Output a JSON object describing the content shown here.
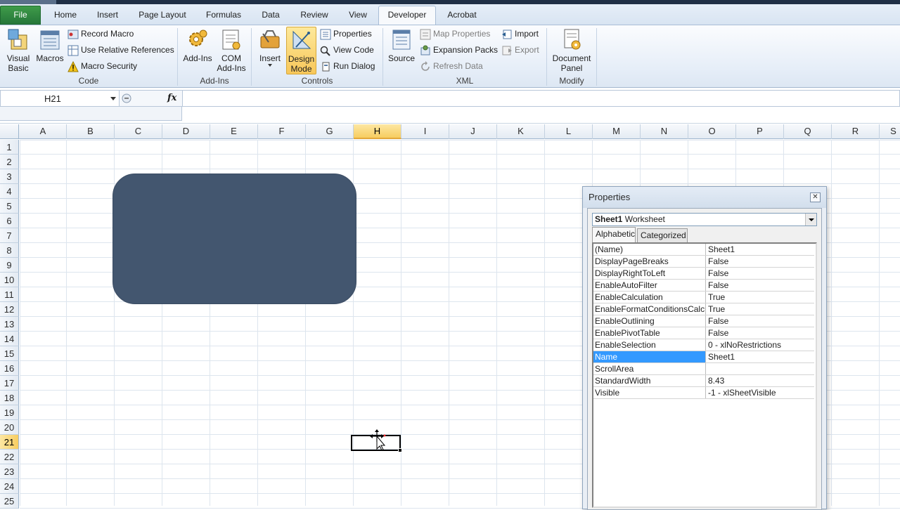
{
  "ribbon_tabs": [
    "File",
    "Home",
    "Insert",
    "Page Layout",
    "Formulas",
    "Data",
    "Review",
    "View",
    "Developer",
    "Acrobat"
  ],
  "active_tab": "Developer",
  "groups": {
    "code": {
      "label": "Code",
      "visual_basic": "Visual\nBasic",
      "macros": "Macros",
      "record_macro": "Record Macro",
      "use_relative": "Use Relative References",
      "macro_security": "Macro Security"
    },
    "addins": {
      "label": "Add-Ins",
      "addins": "Add-Ins",
      "com_addins": "COM\nAdd-Ins"
    },
    "controls": {
      "label": "Controls",
      "insert": "Insert",
      "design_mode": "Design\nMode",
      "properties": "Properties",
      "view_code": "View Code",
      "run_dialog": "Run Dialog"
    },
    "xml": {
      "label": "XML",
      "source": "Source",
      "map_properties": "Map Properties",
      "expansion_packs": "Expansion Packs",
      "refresh_data": "Refresh Data",
      "import": "Import",
      "export": "Export"
    },
    "modify": {
      "label": "Modify",
      "document_panel": "Document\nPanel"
    }
  },
  "formula_bar": {
    "name_box": "H21",
    "fx": "fx",
    "content": ""
  },
  "columns": [
    "A",
    "B",
    "C",
    "D",
    "E",
    "F",
    "G",
    "H",
    "I",
    "J",
    "K",
    "L",
    "M",
    "N",
    "O",
    "P",
    "Q",
    "R",
    "S"
  ],
  "rows": [
    "1",
    "2",
    "3",
    "4",
    "5",
    "6",
    "7",
    "8",
    "9",
    "10",
    "11",
    "12",
    "13",
    "14",
    "15",
    "16",
    "17",
    "18",
    "19",
    "20",
    "21",
    "22",
    "23",
    "24",
    "25"
  ],
  "selected_column": "H",
  "selected_row": "21",
  "properties_window": {
    "title": "Properties",
    "object_name": "Sheet1",
    "object_type": "Worksheet",
    "tabs": [
      "Alphabetic",
      "Categorized"
    ],
    "rows": [
      {
        "key": "(Name)",
        "value": "Sheet1"
      },
      {
        "key": "DisplayPageBreaks",
        "value": "False"
      },
      {
        "key": "DisplayRightToLeft",
        "value": "False"
      },
      {
        "key": "EnableAutoFilter",
        "value": "False"
      },
      {
        "key": "EnableCalculation",
        "value": "True"
      },
      {
        "key": "EnableFormatConditionsCalcula",
        "value": "True"
      },
      {
        "key": "EnableOutlining",
        "value": "False"
      },
      {
        "key": "EnablePivotTable",
        "value": "False"
      },
      {
        "key": "EnableSelection",
        "value": "0 - xlNoRestrictions"
      },
      {
        "key": "Name",
        "value": "Sheet1"
      },
      {
        "key": "ScrollArea",
        "value": ""
      },
      {
        "key": "StandardWidth",
        "value": "8.43"
      },
      {
        "key": "Visible",
        "value": "-1 - xlSheetVisible"
      }
    ],
    "selected_row": "Name"
  },
  "colors": {
    "shape_fill": "#43566f",
    "selection_highlight": "#3399ff",
    "file_tab": "#2f8a3e"
  }
}
